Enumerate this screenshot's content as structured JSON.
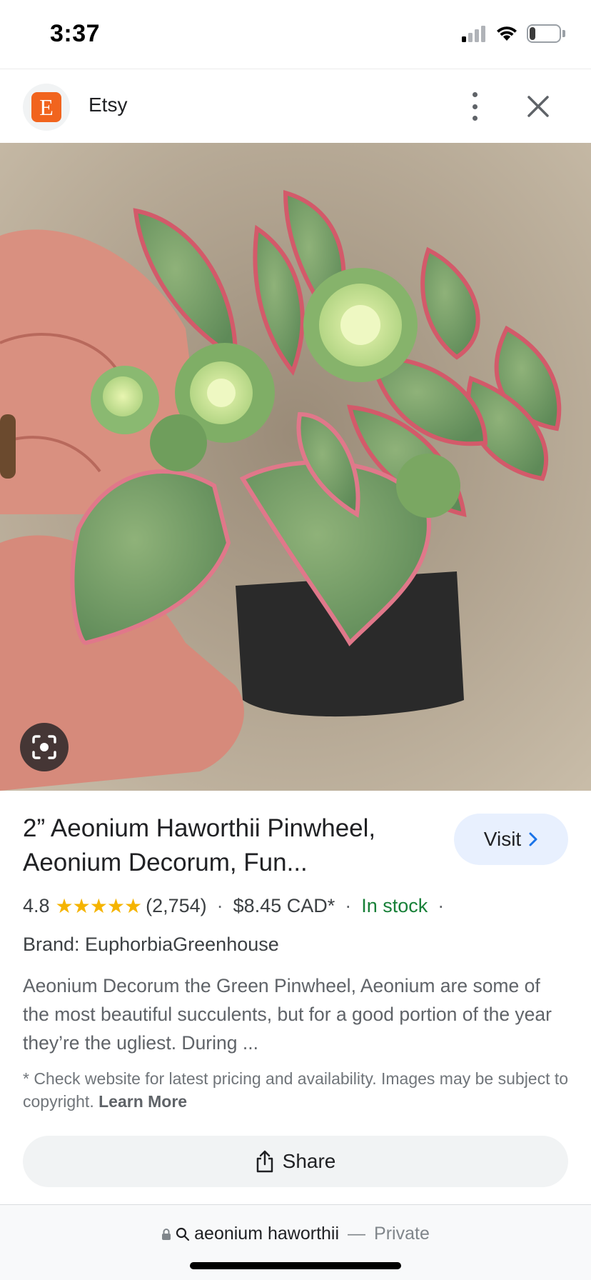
{
  "status_bar": {
    "time": "3:37",
    "battery_percent": "21",
    "battery_level": 0.21
  },
  "header": {
    "site_name": "Etsy",
    "logo_letter": "E"
  },
  "product": {
    "title_line1": "2” Aeonium Haworthii Pinwheel,",
    "title_line2": "Aeonium Decorum, Fun...",
    "visit_label": "Visit",
    "rating": "4.8",
    "stars_count": 5,
    "review_count": "(2,754)",
    "price": "$8.45 CAD*",
    "stock_status": "In stock",
    "brand": "Brand: EuphorbiaGreenhouse",
    "description": "Aeonium Decorum the Green Pinwheel, Aeonium are some of the most beautiful succulents, but for a good portion of the year they’re the ugliest. During ...",
    "disclaimer": "* Check website for latest pricing and availability. Images may be subject to copyright.",
    "learn_more": "Learn More",
    "share_label": "Share"
  },
  "url_bar": {
    "query": "aeonium haworthii",
    "separator": "—",
    "mode": "Private"
  },
  "colors": {
    "accent": "#1a73e8",
    "etsy_orange": "#f1641e",
    "in_stock_green": "#188038",
    "star_yellow": "#f5b400"
  },
  "icons": [
    "signal-icon",
    "wifi-icon",
    "battery-icon",
    "more-vert-icon",
    "close-icon",
    "lens-icon",
    "chevron-right-icon",
    "share-icon",
    "lock-icon",
    "search-icon"
  ]
}
